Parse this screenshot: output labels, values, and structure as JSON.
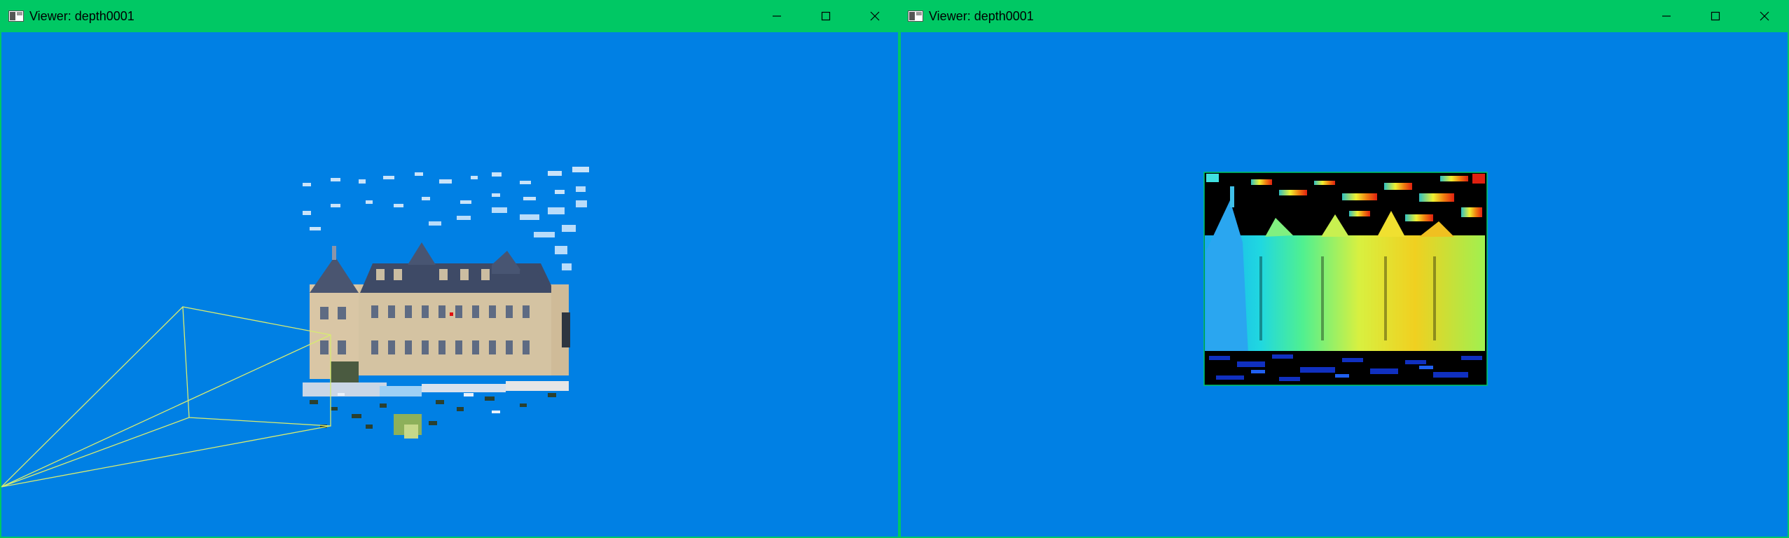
{
  "windows": [
    {
      "title": "Viewer: depth0001",
      "content": "3D point cloud of a château with camera frustum",
      "controls": [
        "minimize-icon",
        "maximize-icon",
        "close-icon"
      ]
    },
    {
      "title": "Viewer: depth0001",
      "content": "depth map rendered with jet colormap",
      "controls": [
        "minimize-icon",
        "maximize-icon",
        "close-icon"
      ]
    }
  ],
  "colors": {
    "background": "#0080e4",
    "titlebar": "#00c864",
    "frustum": "#d8ec70",
    "depth_border": "#00c864"
  }
}
